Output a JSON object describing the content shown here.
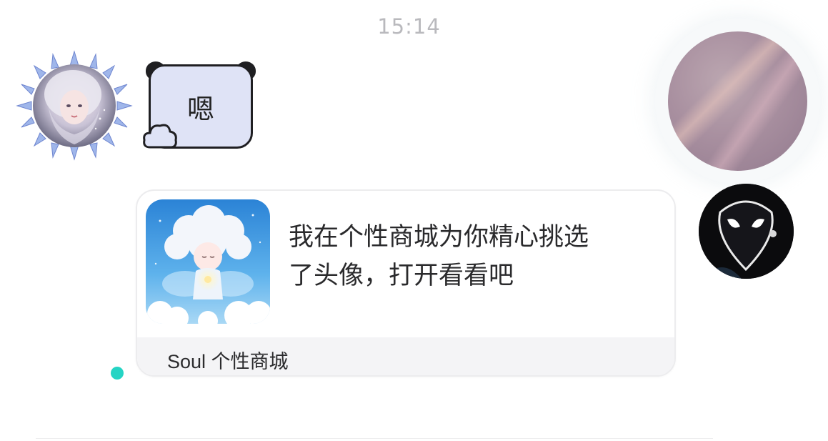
{
  "chat": {
    "timestamp": "15:14",
    "sticker_text": "嗯",
    "card": {
      "message": "我在个性商城为你精心挑选\n了头像，打开看看吧",
      "footer": "Soul 个性商城"
    }
  },
  "colors": {
    "online_dot": "#25d4c4",
    "sticker_bubble": "#dfe3f6",
    "card_footer_bg": "#f4f4f6"
  },
  "icons": {
    "sender_avatar": "crystal-frame-girl-avatar",
    "sticker_decor": "cloud-icon",
    "receiver_avatar_top": "blurred-pink-avatar",
    "receiver_avatar_bottom": "alien-avatar",
    "card_thumbnail": "cloud-fairy-image"
  }
}
